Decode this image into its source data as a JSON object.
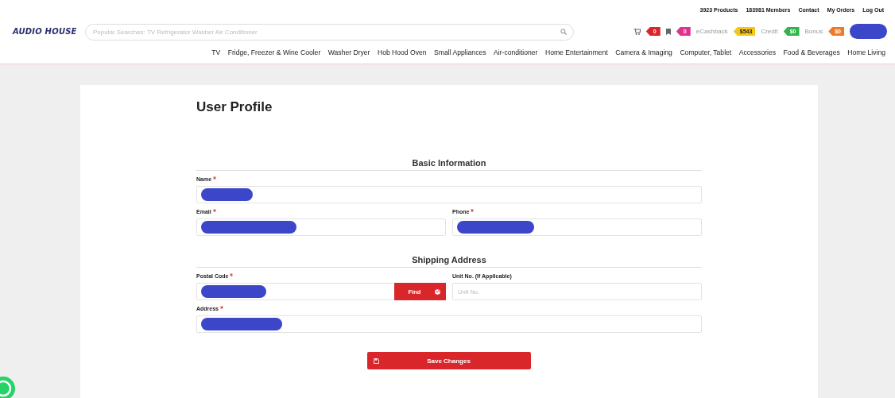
{
  "top_links": [
    "3923 Products",
    "183981 Members",
    "Contact",
    "My Orders",
    "Log Out"
  ],
  "logo": {
    "text": "AUDIO HOUSE"
  },
  "search": {
    "placeholder": "Popular Searches: TV Refrigerator Washer Air Conditioner"
  },
  "counters": [
    {
      "kind": "cart",
      "value": "0",
      "color": "#d9262b"
    },
    {
      "kind": "bookmark",
      "value": "0",
      "color": "#e0338f"
    },
    {
      "kind": "text",
      "label": "eCashback",
      "value": "$543",
      "color": "#f5c518"
    },
    {
      "kind": "text",
      "label": "Credit",
      "value": "$0",
      "color": "#2fb54a"
    },
    {
      "kind": "text",
      "label": "Bonus",
      "value": "$0",
      "color": "#ef7a27"
    }
  ],
  "account": {
    "redacted": true
  },
  "nav": [
    "TV",
    "Fridge, Freezer & Wine Cooler",
    "Washer Dryer",
    "Hob Hood Oven",
    "Small Appliances",
    "Air-conditioner",
    "Home Entertainment",
    "Camera & Imaging",
    "Computer, Tablet",
    "Accessories",
    "Food & Beverages",
    "Home Living"
  ],
  "profile": {
    "title": "User Profile",
    "sections": [
      {
        "heading": "Basic Information",
        "rows": [
          {
            "fields": [
              {
                "label": "Name",
                "required": true,
                "redacted": true
              }
            ]
          },
          {
            "fields": [
              {
                "label": "Email",
                "required": true,
                "redacted": true
              },
              {
                "label": "Phone",
                "required": true,
                "redacted": true
              }
            ]
          }
        ]
      },
      {
        "heading": "Shipping Address",
        "rows": [
          {
            "fields": [
              {
                "label": "Postal Code",
                "required": true,
                "redacted": true,
                "button": {
                  "label": "Find"
                }
              },
              {
                "label": "Unit No. (If Applicable)",
                "required": false,
                "redacted": false,
                "placeholder": "Unit No."
              }
            ]
          },
          {
            "fields": [
              {
                "label": "Address",
                "required": true,
                "redacted": true
              }
            ]
          }
        ]
      }
    ],
    "save_button": {
      "label": "Save Changes"
    }
  }
}
